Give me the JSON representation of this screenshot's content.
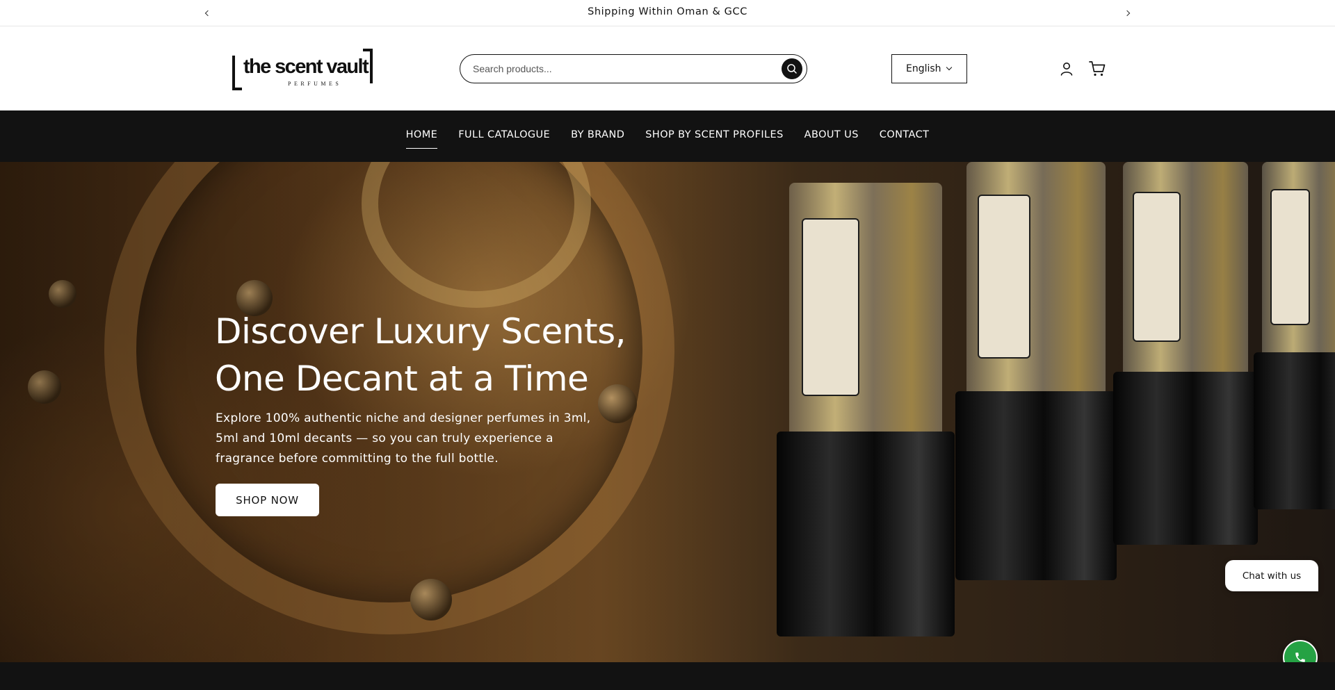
{
  "announcement": {
    "message": "Shipping Within Oman & GCC",
    "prev_icon": "chevron-left-icon",
    "next_icon": "chevron-right-icon"
  },
  "header": {
    "logo": {
      "wordmark": "the scent vault",
      "subtitle": "PERFUMES"
    },
    "search": {
      "placeholder": "Search products...",
      "value": "",
      "icon": "search-icon"
    },
    "language": {
      "selected": "English",
      "icon": "chevron-down-icon"
    },
    "account_icon": "user-icon",
    "cart_icon": "cart-icon"
  },
  "nav": {
    "items": [
      {
        "label": "HOME",
        "active": true
      },
      {
        "label": "FULL CATALOGUE",
        "active": false
      },
      {
        "label": "BY BRAND",
        "active": false
      },
      {
        "label": "SHOP BY SCENT PROFILES",
        "active": false
      },
      {
        "label": "ABOUT US",
        "active": false
      },
      {
        "label": "CONTACT",
        "active": false
      }
    ]
  },
  "hero": {
    "title_line1": "Discover Luxury Scents,",
    "title_line2": "One Decant at a Time",
    "description": "Explore 100% authentic niche and designer perfumes in 3ml, 5ml and 10ml decants — so you can truly experience a fragrance before committing to the full bottle.",
    "cta_label": "SHOP NOW"
  },
  "chat": {
    "bubble_label": "Chat with us",
    "button_icon": "phone-icon",
    "accent": "#25a244"
  },
  "colors": {
    "nav_bg": "#121212",
    "text": "#121212",
    "white": "#ffffff"
  }
}
